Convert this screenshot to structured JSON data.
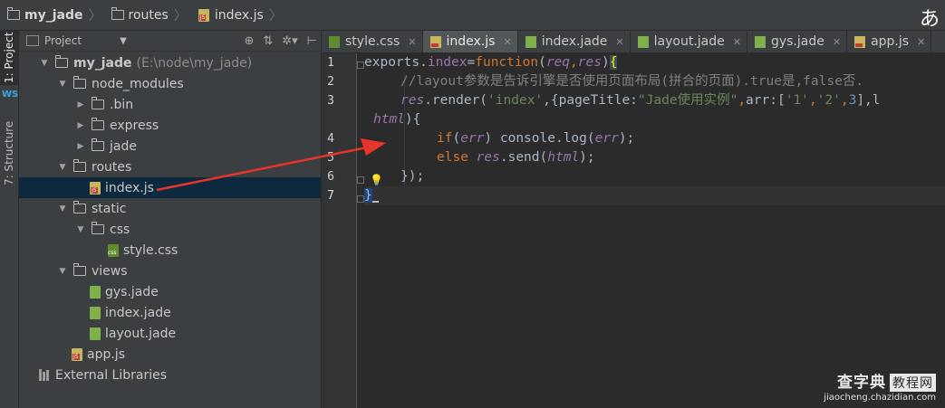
{
  "breadcrumb": {
    "items": [
      {
        "label": "my_jade",
        "icon": "folder-icon"
      },
      {
        "label": "routes",
        "icon": "folder-icon"
      },
      {
        "label": "index.js",
        "icon": "js-file-icon"
      }
    ],
    "corner_glyph": "あ"
  },
  "tool_strip": {
    "project_tab": "1: Project",
    "structure_tab": "7: Structure"
  },
  "project_panel": {
    "title": "Project",
    "tree": [
      {
        "label": "my_jade",
        "extra": "(E:\\node\\my_jade)",
        "kind": "folder",
        "expanded": true,
        "depth": 0
      },
      {
        "label": "node_modules",
        "kind": "folder",
        "expanded": true,
        "depth": 1
      },
      {
        "label": ".bin",
        "kind": "folder",
        "expanded": false,
        "depth": 2
      },
      {
        "label": "express",
        "kind": "folder",
        "expanded": false,
        "depth": 2
      },
      {
        "label": "jade",
        "kind": "folder",
        "expanded": false,
        "depth": 2
      },
      {
        "label": "routes",
        "kind": "folder",
        "expanded": true,
        "depth": 1
      },
      {
        "label": "index.js",
        "kind": "js",
        "depth": 2,
        "selected": true
      },
      {
        "label": "static",
        "kind": "folder",
        "expanded": true,
        "depth": 1
      },
      {
        "label": "css",
        "kind": "folder",
        "expanded": true,
        "depth": 2
      },
      {
        "label": "style.css",
        "kind": "css",
        "depth": 3
      },
      {
        "label": "views",
        "kind": "folder",
        "expanded": true,
        "depth": 1
      },
      {
        "label": "gys.jade",
        "kind": "jade",
        "depth": 2
      },
      {
        "label": "index.jade",
        "kind": "jade",
        "depth": 2
      },
      {
        "label": "layout.jade",
        "kind": "jade",
        "depth": 2
      },
      {
        "label": "app.js",
        "kind": "js",
        "depth": 1
      },
      {
        "label": "External Libraries",
        "kind": "libs",
        "depth": 0
      }
    ]
  },
  "editor": {
    "tabs": [
      {
        "label": "style.css",
        "kind": "css",
        "active": false
      },
      {
        "label": "index.js",
        "kind": "js",
        "active": true
      },
      {
        "label": "index.jade",
        "kind": "jade",
        "active": false
      },
      {
        "label": "layout.jade",
        "kind": "jade",
        "active": false
      },
      {
        "label": "gys.jade",
        "kind": "jade",
        "active": false
      },
      {
        "label": "app.js",
        "kind": "js",
        "active": false
      }
    ],
    "line_numbers": [
      "1",
      "2",
      "3",
      "4",
      "5",
      "6",
      "7"
    ],
    "code": {
      "l1": {
        "a": "exports",
        "b": ".",
        "c": "index",
        "d": "=",
        "e": "function",
        "f": "(",
        "g": "req",
        "h": ",",
        "i": "res",
        "j": ")",
        "k": "{"
      },
      "l2": {
        "a": "//layout参数是告诉引擎是否使用页面布局(拼合的页面).true是,false否."
      },
      "l3": {
        "a": "res",
        "b": ".render(",
        "c": "'index'",
        "d": ",{pageTitle:",
        "e": "\"Jade使用实例\"",
        "f": ",",
        "g": "arr",
        "h": ":[",
        "i": "'1'",
        "j": ",",
        "k": "'2'",
        "l": ",",
        "m": "3",
        "n": "],l"
      },
      "l3w": {
        "a": "html",
        "b": "){"
      },
      "l4": {
        "a": "if",
        "b": "(",
        "c": "err",
        "d": ") console.log(",
        "e": "err",
        "f": ");"
      },
      "l5": {
        "a": "else ",
        "b": "res",
        "c": ".send(",
        "d": "html",
        "e": ");"
      },
      "l6": {
        "a": "});"
      },
      "l7": {
        "a": "}"
      }
    }
  },
  "watermark": {
    "main": "查字典",
    "boxed": "教程网",
    "url": "jiaocheng.chazidian.com"
  },
  "colors": {
    "keyword": "#cc7832",
    "string": "#6a8759",
    "comment": "#808080",
    "param": "#9876aa",
    "annotation_arrow": "#e8352b"
  }
}
